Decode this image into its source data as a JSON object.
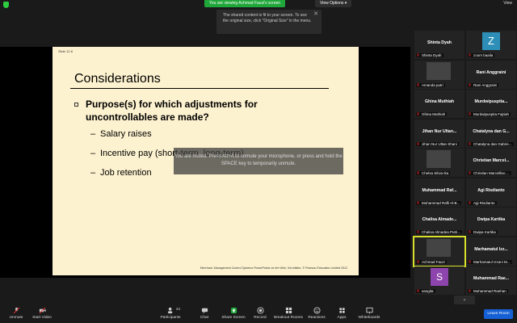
{
  "top": {
    "viewing_banner": "You are viewing Achmad Fauzi's screen",
    "view_options": "View Options ▾",
    "view_label": "View",
    "tooltip": "The shared content is fit to your screen. To see the original size, click \"Original Size\" in the menu."
  },
  "slide": {
    "number": "Slide 12.8",
    "title": "Considerations",
    "main_bullet": "Purpose(s) for which adjustments for uncontrollables are made?",
    "subs": [
      "Salary raises",
      "Incentive pay (short-term, long-term)",
      "Job retention"
    ],
    "footer": "Merchant, Management Control Systems PowerPoints on the Web, 3rd edition, © Pearson Education Limited 2012"
  },
  "toast": "You are muted. Press Alt+A to unmute your microphone, or press and hold the SPACE key to temporarily unmute.",
  "participants": [
    {
      "top": "Shinta Dyah",
      "bottom": "Shinta Dyah"
    },
    {
      "top": "",
      "bottom": "zoom baaila",
      "avatar": "Z"
    },
    {
      "top": "",
      "bottom": "Amanda putri",
      "thumb": true
    },
    {
      "top": "Rani Anggraini",
      "bottom": "Rani Anggraini"
    },
    {
      "top": "Ghina Muthiah",
      "bottom": "Ghina Muthiah"
    },
    {
      "top": "Murdwipuspita...",
      "bottom": "Murdwipuspita Fajriah"
    },
    {
      "top": "Jihan Nur Ultan...",
      "bottom": "Jihan Nur Ultan Shani"
    },
    {
      "top": "Chatalyna dan G...",
      "bottom": "Chatalyna dan Gabrie..."
    },
    {
      "top": "",
      "bottom": "Chelsa Silvia Ika",
      "thumb": true
    },
    {
      "top": "Christian  Marcel...",
      "bottom": "Christian Marcellino ..."
    },
    {
      "top": "Muhammad  Raf...",
      "bottom": "Muhammad Rafli Al-B..."
    },
    {
      "top": "Agi Risdianto",
      "bottom": "Agi Risdianto"
    },
    {
      "top": "Chalisa  Almade...",
      "bottom": "Chalisa Almadea Putri..."
    },
    {
      "top": "Dwipa Kartika",
      "bottom": "Dwipa Kartika"
    },
    {
      "top": "",
      "bottom": "Achmad Fauzi",
      "thumb": true,
      "active": true
    },
    {
      "top": "Marhamatul  Izz...",
      "bottom": "Marhamatul Izzani M..."
    },
    {
      "top": "",
      "bottom": "sangita",
      "avatar": "S"
    },
    {
      "top": "Muhammad  Rae...",
      "bottom": "Muhammad Raehan"
    }
  ],
  "toolbar": {
    "unmute": "Unmute",
    "start_video": "Start Video",
    "participants": "Participants",
    "participants_count": "24",
    "chat": "Chat",
    "share_screen": "Share Screen",
    "record": "Record",
    "breakout_rooms": "Breakout Rooms",
    "reactions": "Reactions",
    "apps": "Apps",
    "whiteboards": "Whiteboards",
    "leave": "Leave Room"
  },
  "colors": {
    "accent_green": "#1fa73a",
    "leave_blue": "#1560d4",
    "slide_bg": "#fdf2cf",
    "active_tile": "#d8e02a"
  }
}
